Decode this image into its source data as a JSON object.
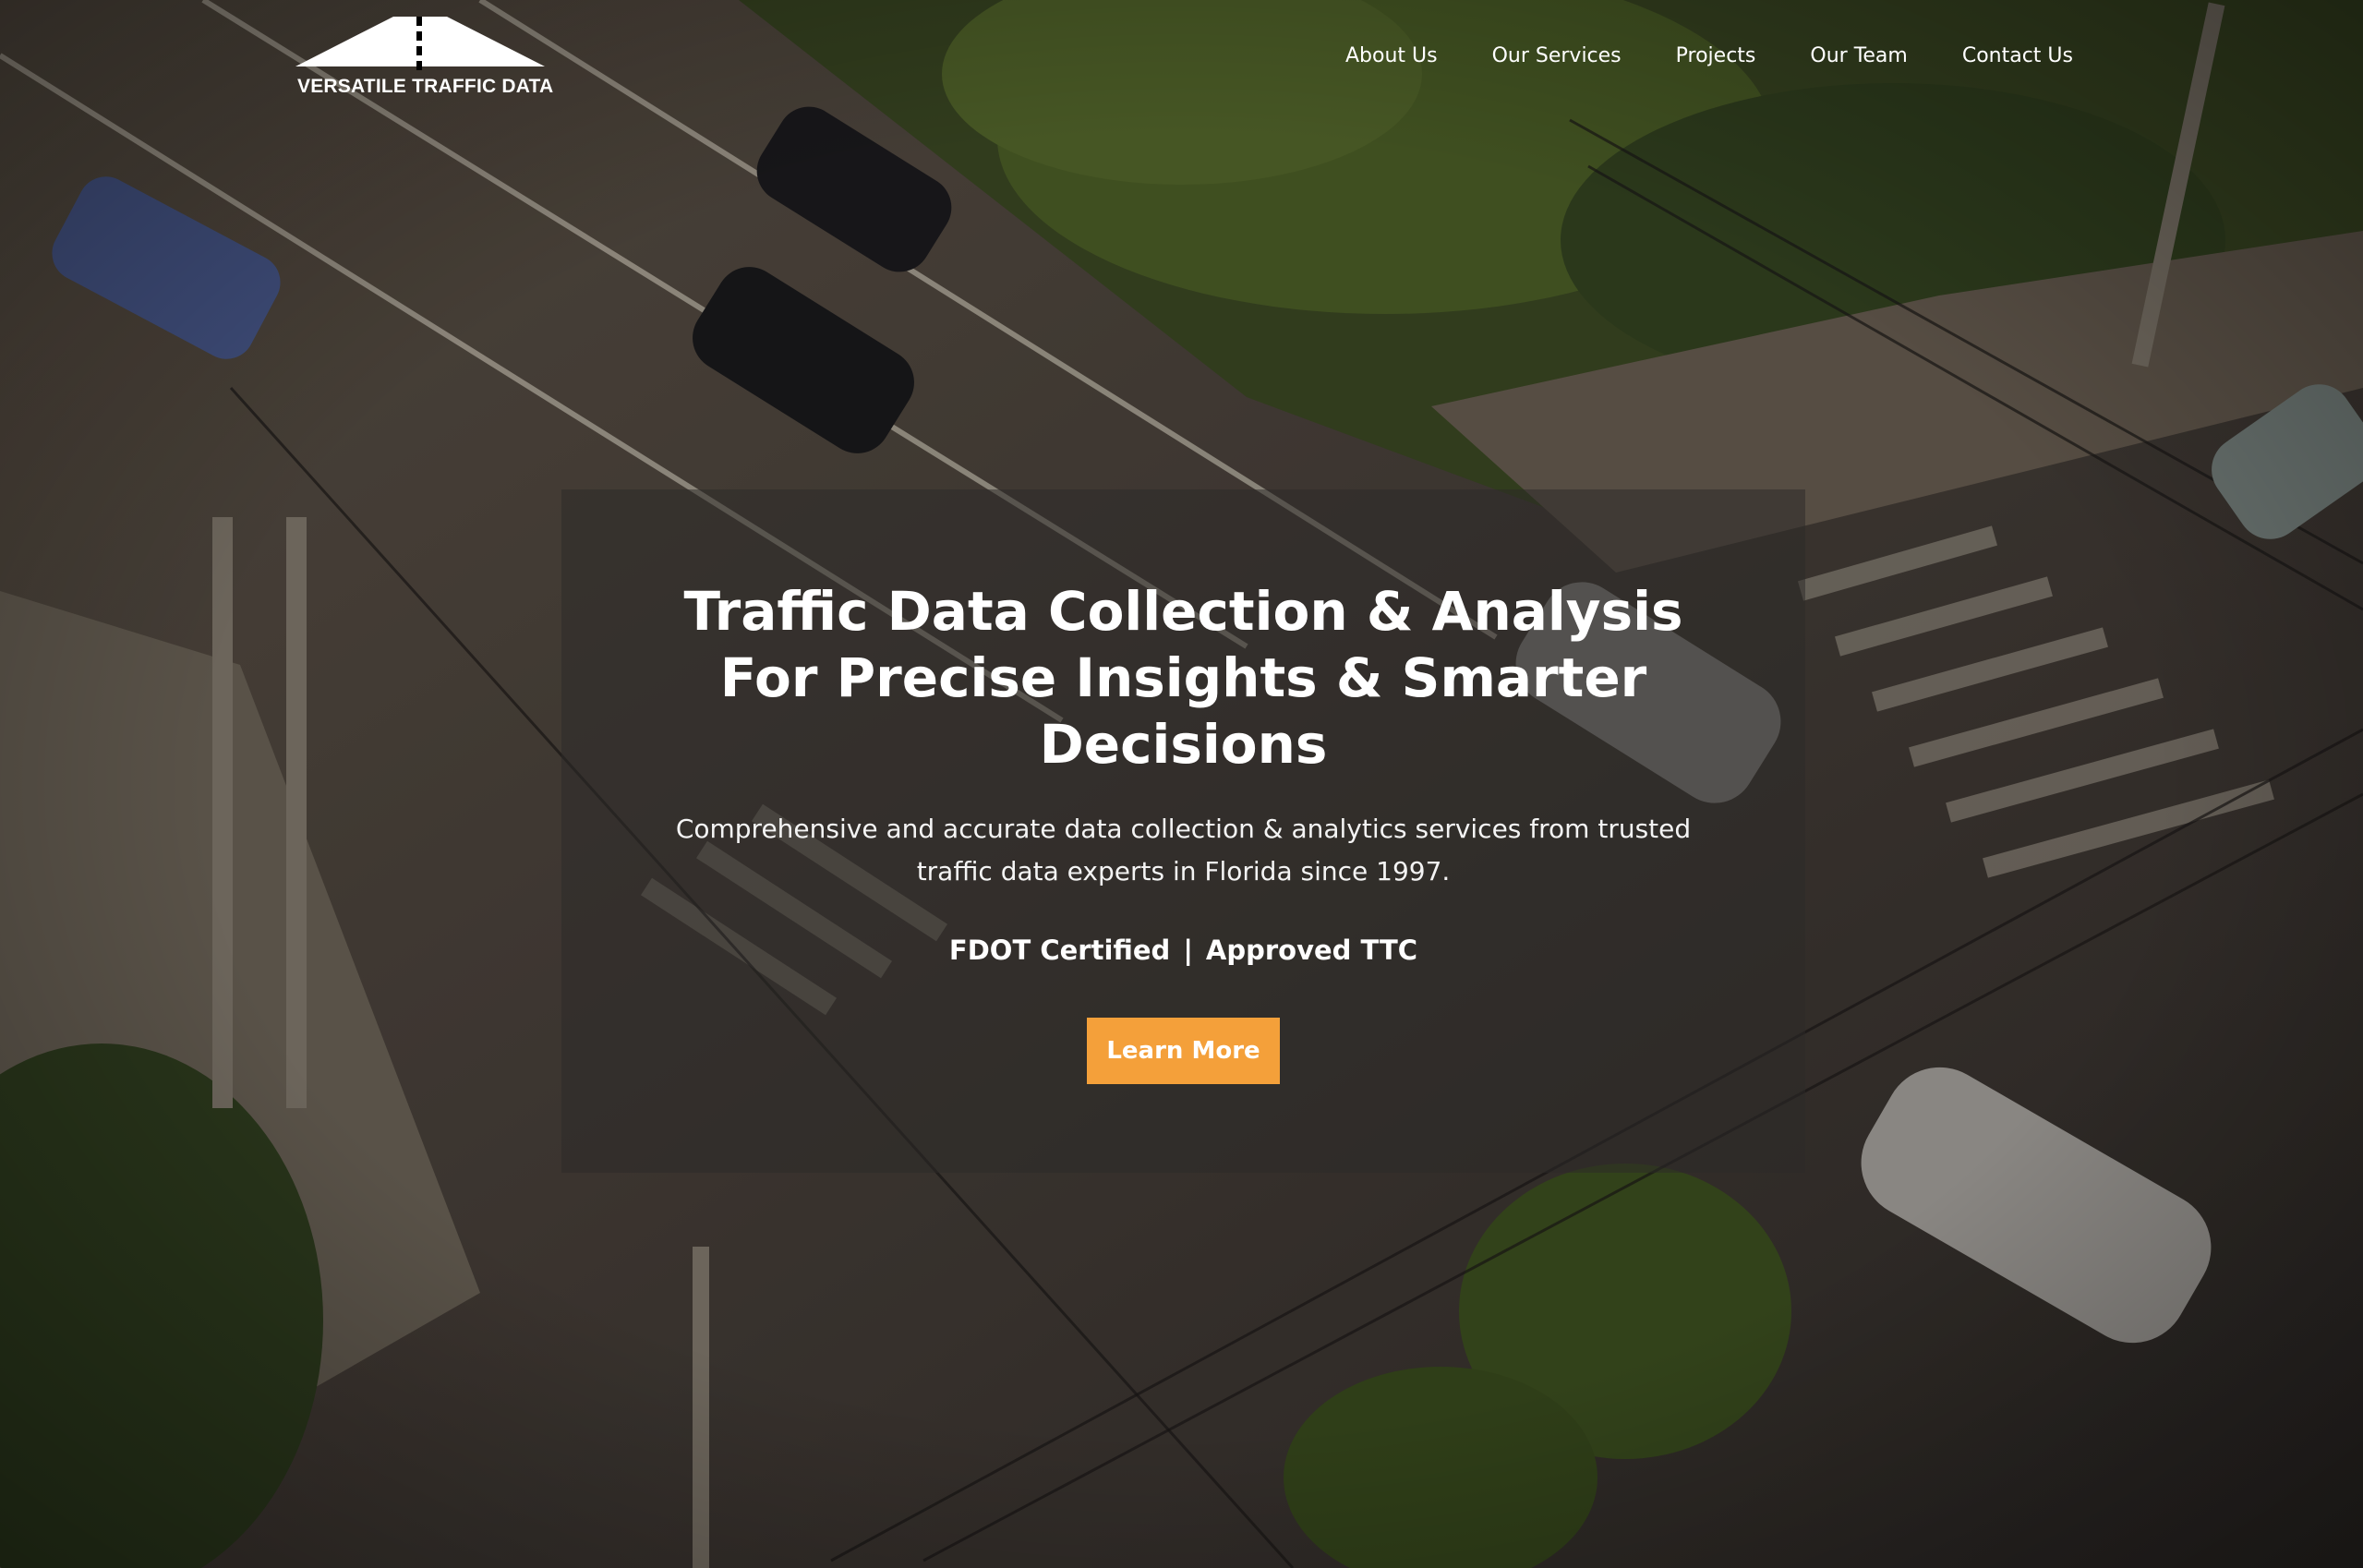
{
  "brand": {
    "logo_text": "VERSATILE TRAFFIC DATA"
  },
  "nav": {
    "items": [
      {
        "label": "About Us"
      },
      {
        "label": "Our Services"
      },
      {
        "label": "Projects"
      },
      {
        "label": "Our Team"
      },
      {
        "label": "Contact Us"
      }
    ]
  },
  "hero": {
    "title_lines": [
      "Traffic Data Collection & Analysis",
      "For Precise Insights & Smarter",
      "Decisions"
    ],
    "subtitle_lines": [
      "Comprehensive and accurate data collection & analytics services from trusted",
      "traffic data experts in Florida since 1997."
    ],
    "cert_1": "FDOT Certified",
    "cert_separator": "|",
    "cert_2": "Approved TTC",
    "cta_label": "Learn More"
  },
  "colors": {
    "accent": "#f4a03a",
    "text": "#ffffff",
    "panel": "rgba(45,42,40,0.52)"
  }
}
